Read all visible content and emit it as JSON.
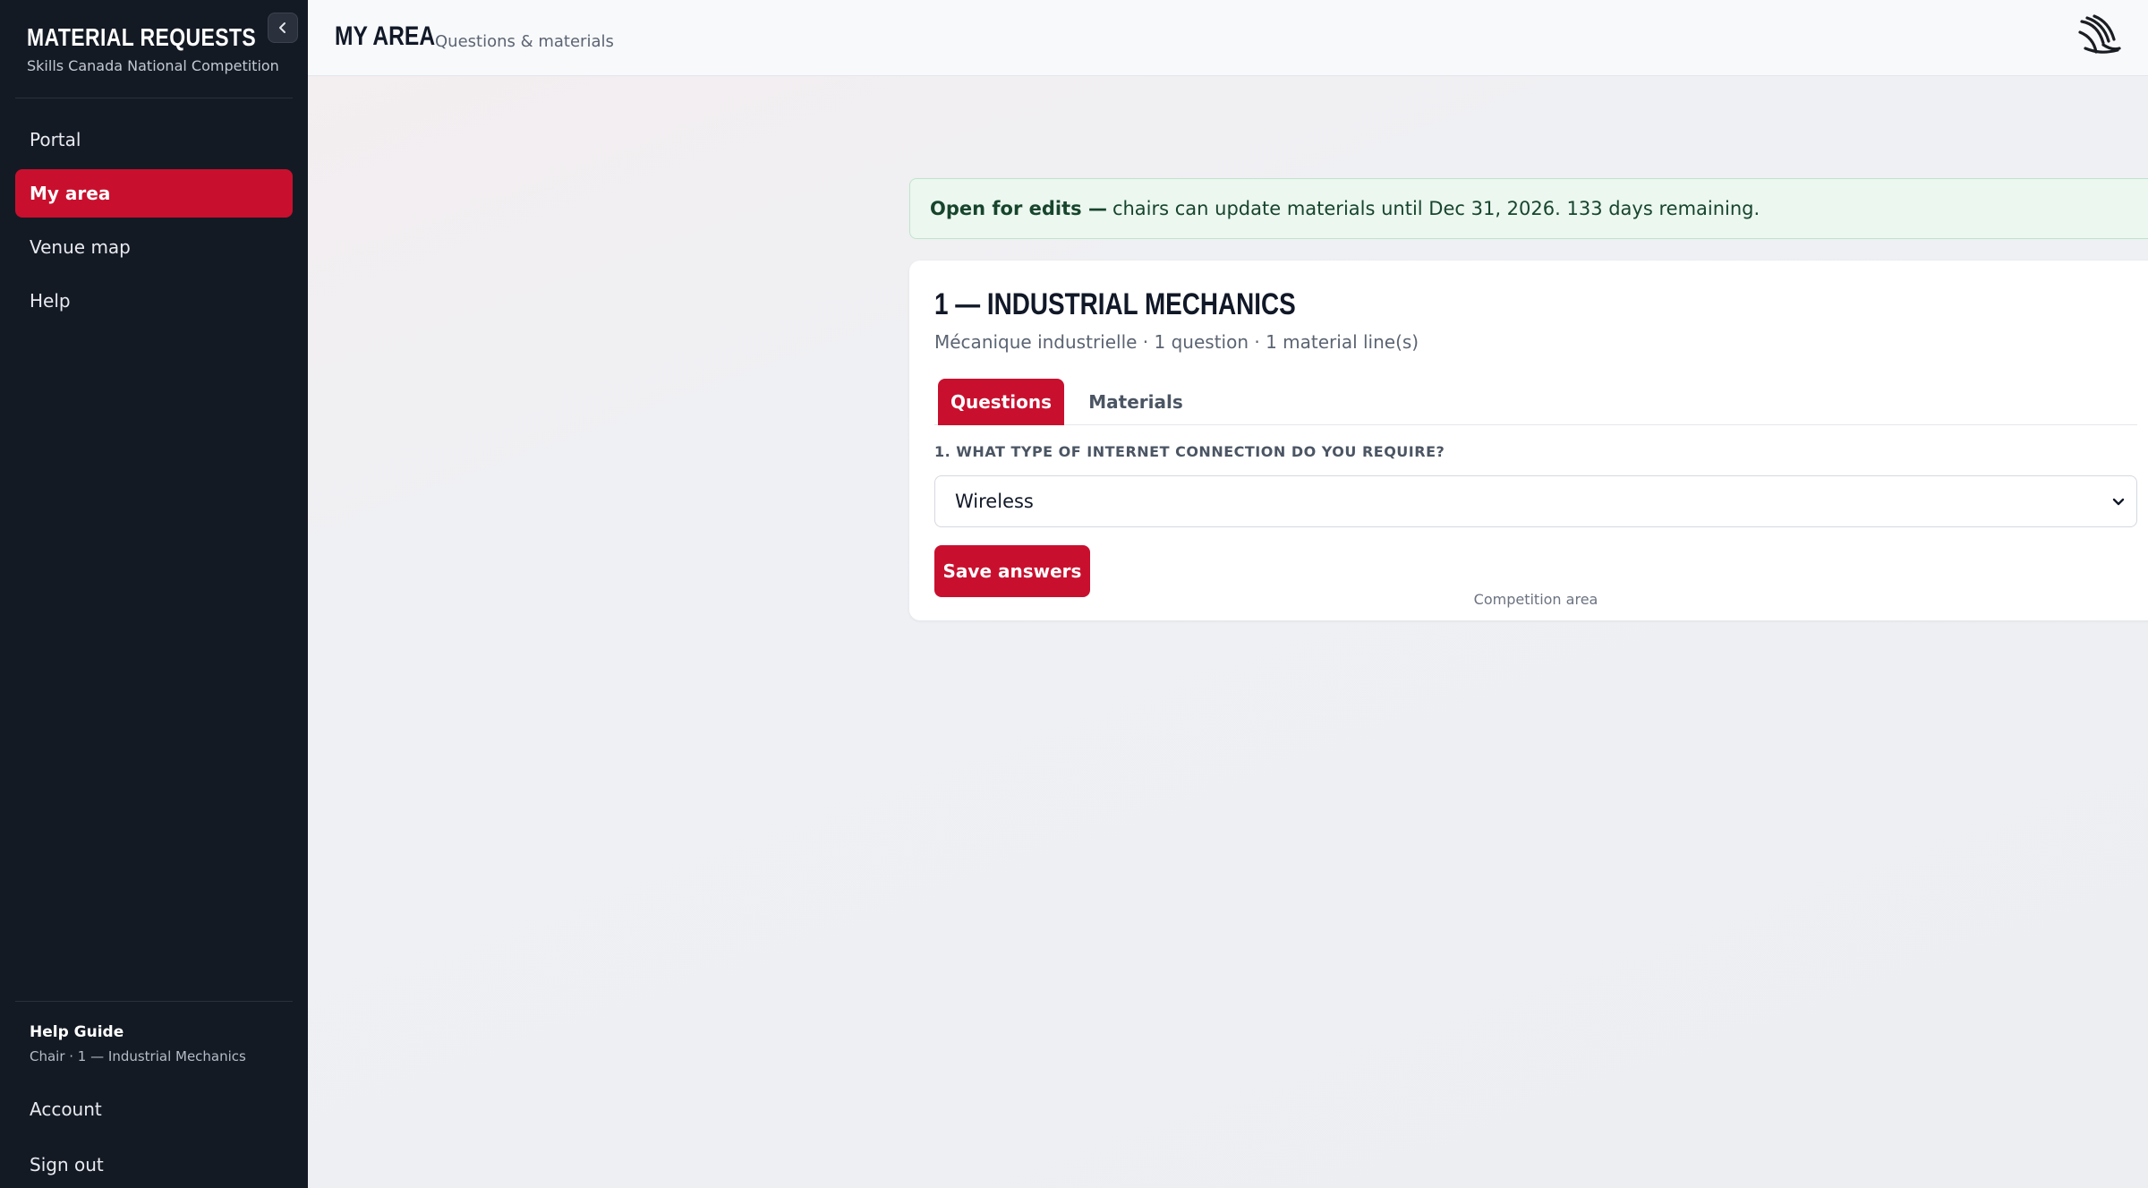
{
  "sidebar": {
    "brand_title": "MATERIAL REQUESTS",
    "brand_subtitle": "Skills Canada National Competition",
    "collapse_icon": "chevron-left-icon",
    "nav": [
      {
        "label": "Portal"
      },
      {
        "label": "My area",
        "active": true
      },
      {
        "label": "Venue map"
      },
      {
        "label": "Help"
      }
    ],
    "help_guide": {
      "title": "Help Guide",
      "subtitle": "Chair · 1 — Industrial Mechanics"
    },
    "account_label": "Account",
    "signout_label": "Sign out"
  },
  "header": {
    "title": "MY AREA",
    "subtitle": "Questions & materials",
    "logo_icon": "brand-logo-icon"
  },
  "notice": {
    "strong": "Open for edits —",
    "text": "chairs can update materials until Dec 31, 2026. 133 days remaining."
  },
  "card": {
    "title": "1 — INDUSTRIAL MECHANICS",
    "meta": "Mécanique industrielle · 1 question · 1 material line(s)",
    "tabs": [
      {
        "label": "Questions",
        "active": true
      },
      {
        "label": "Materials"
      }
    ],
    "question_label": "1. WHAT TYPE OF INTERNET CONNECTION DO YOU REQUIRE?",
    "select_value": "Wireless",
    "save_label": "Save answers"
  },
  "footer_note": "Competition area",
  "colors": {
    "accent": "#c8102e",
    "sidebar_bg": "#141a24",
    "notice_bg": "#ecf7f0",
    "notice_text": "#17452c"
  }
}
